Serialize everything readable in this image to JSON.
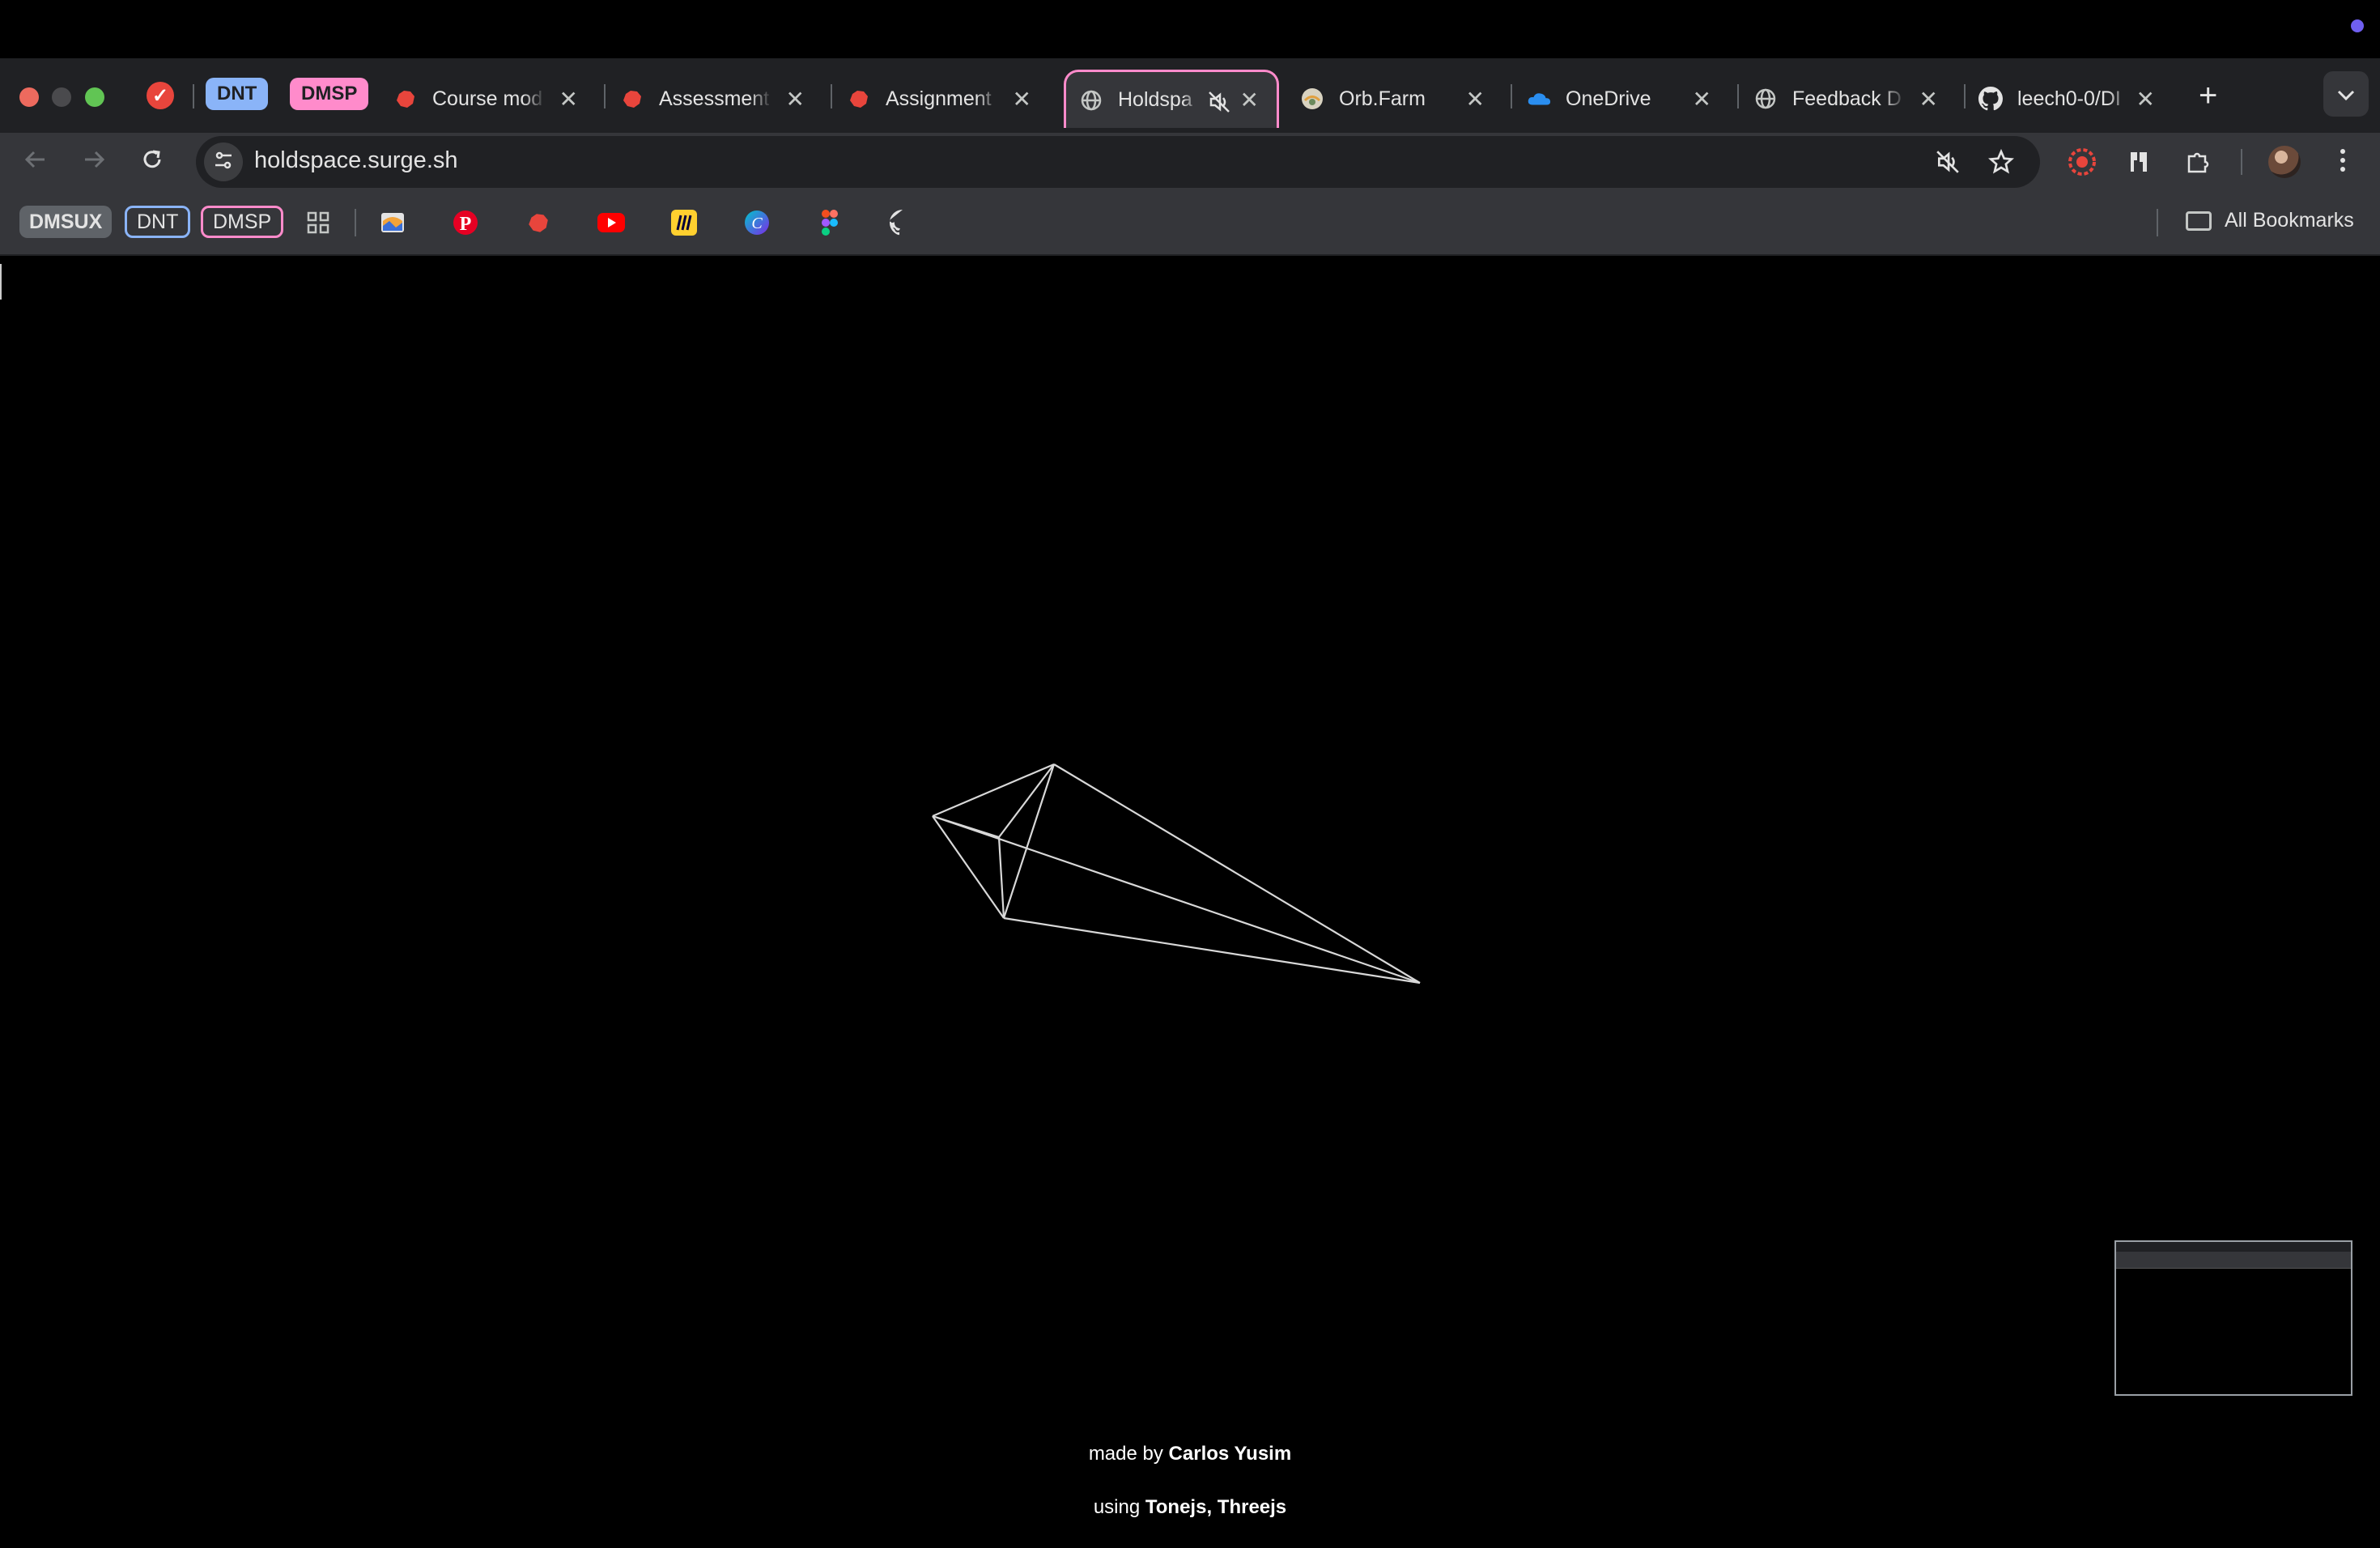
{
  "tabs": [
    {
      "title": "Course mod",
      "favicon": "red-blob-icon"
    },
    {
      "title": "Assessment",
      "favicon": "red-blob-icon"
    },
    {
      "title": "Assignment",
      "favicon": "red-blob-icon"
    },
    {
      "title": "Holdspa",
      "favicon": "globe-icon",
      "active": true,
      "muted": true
    },
    {
      "title": "Orb.Farm",
      "favicon": "orb-icon"
    },
    {
      "title": "OneDrive",
      "favicon": "onedrive-cloud-icon"
    },
    {
      "title": "Feedback D",
      "favicon": "globe-icon"
    },
    {
      "title": "leech0-0/DI",
      "favicon": "github-icon"
    }
  ],
  "tab_groups": {
    "dnt": "DNT",
    "dmsp": "DMSP"
  },
  "close_glyph": "✕",
  "new_tab_glyph": "+",
  "address_bar": {
    "url": "holdspace.surge.sh"
  },
  "bookmarks": {
    "chips": [
      "DMSUX",
      "DNT",
      "DMSP"
    ],
    "icons": [
      "apps-grid-icon",
      "photos-icon",
      "pinterest-icon",
      "red-blob-icon",
      "youtube-icon",
      "miro-icon",
      "canva-icon",
      "figma-icon",
      "github-icon"
    ],
    "all_bookmarks": "All Bookmarks"
  },
  "page": {
    "credit_prefix": "made by",
    "author": "Carlos Yusim",
    "using_prefix": "using",
    "lib1": "Tonejs",
    "lib_sep": ",",
    "lib2": "Threejs"
  },
  "colors": {
    "accent_group_dnt": "#8ab4f8",
    "accent_group_dmsp": "#ff8bcb",
    "page_bg": "#000000"
  }
}
